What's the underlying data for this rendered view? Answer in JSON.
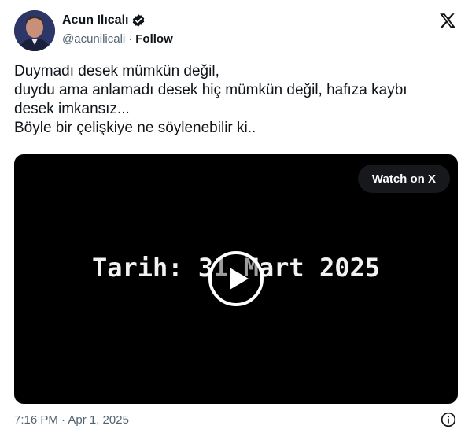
{
  "author": {
    "display_name": "Acun Ilıcalı",
    "handle": "@acunilicali",
    "separator": "·",
    "follow_label": "Follow",
    "verified": true
  },
  "tweet": {
    "lines": [
      "Duymadı desek mümkün değil,",
      "duydu ama anlamadı desek hiç mümkün değil, hafıza kaybı",
      "desek imkansız...",
      "Böyle bir çelişkiye ne söylenebilir ki.."
    ]
  },
  "video": {
    "caption": "Tarih: 31 Mart 2025",
    "watch_label": "Watch on X"
  },
  "footer": {
    "timestamp": "7:16 PM · Apr 1, 2025"
  },
  "icons": {
    "verified": "verified-badge-icon",
    "platform": "x-logo-icon",
    "play": "play-icon",
    "info": "info-icon"
  },
  "colors": {
    "text": "#0f1419",
    "secondary": "#536471",
    "video_bg": "#000000"
  }
}
